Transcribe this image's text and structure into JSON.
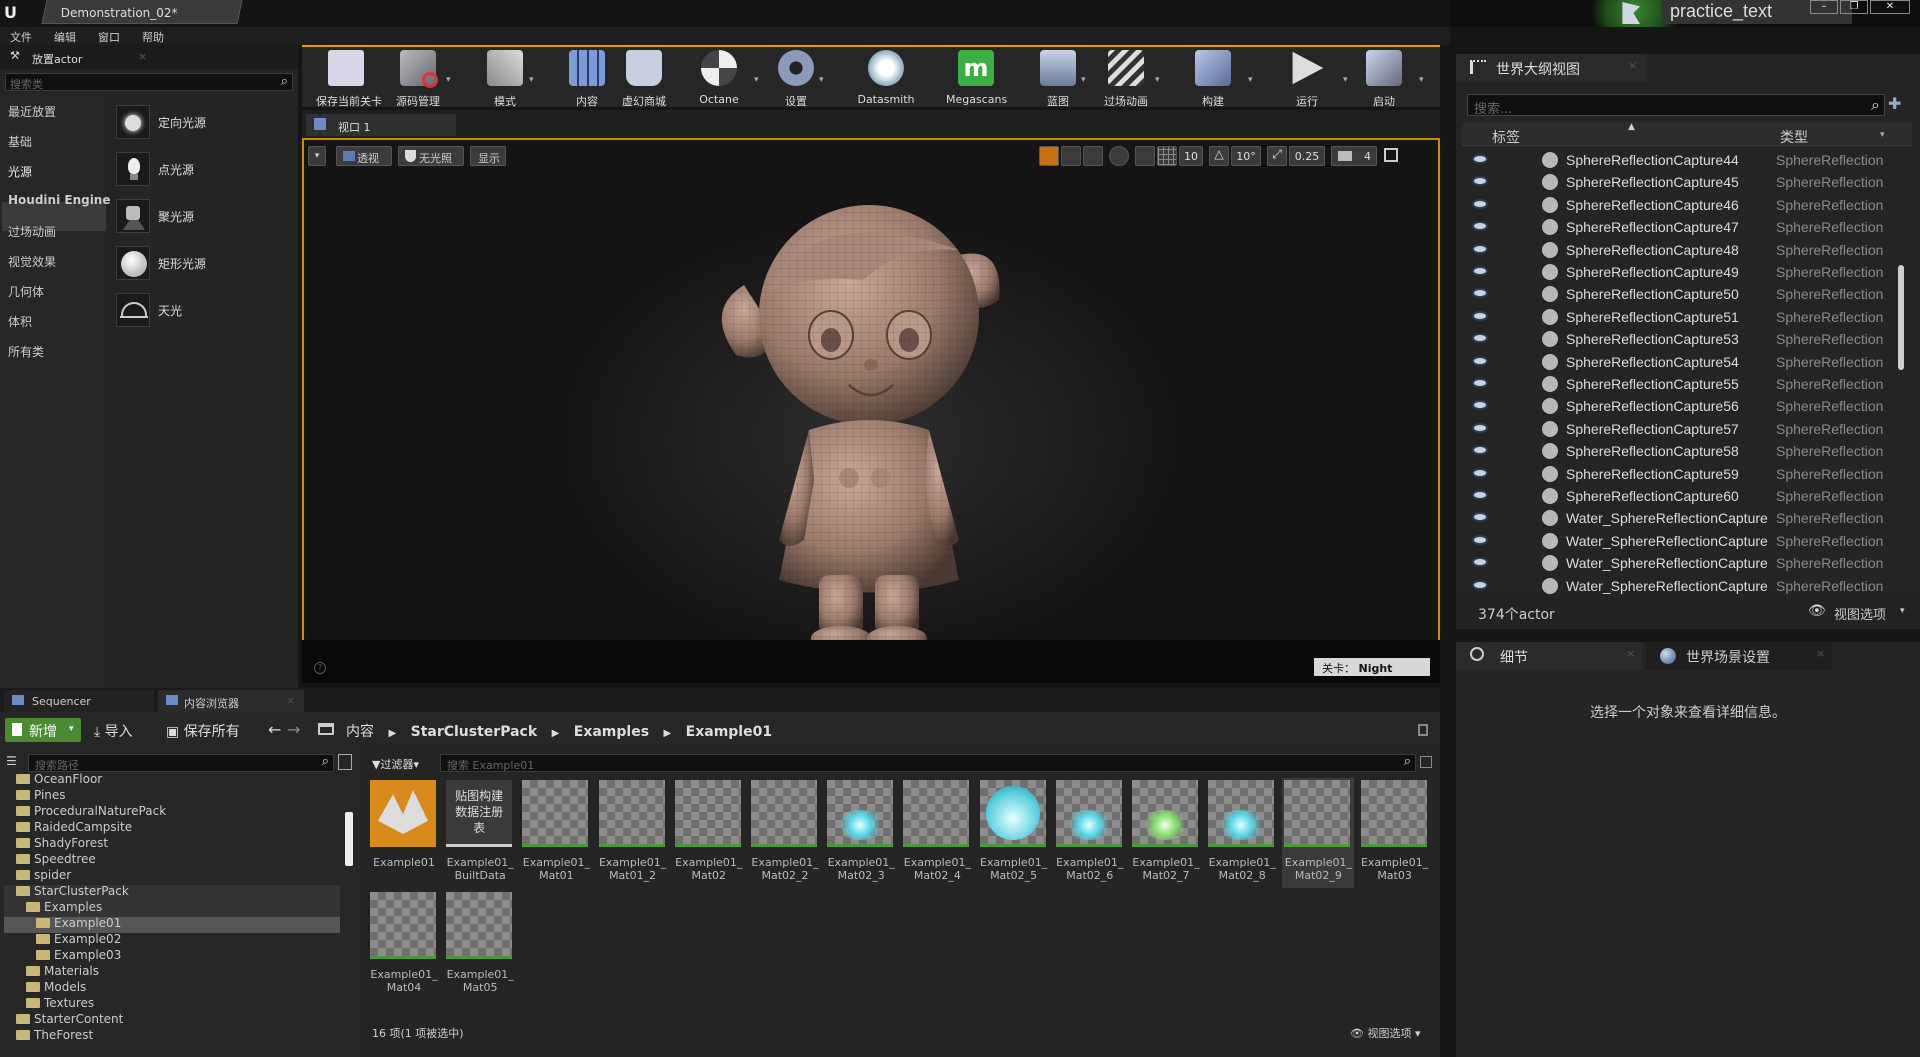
{
  "app": {
    "logo": "unreal-logo-icon",
    "document_tab": "Demonstration_02*"
  },
  "menu": [
    "文件",
    "编辑",
    "窗口",
    "帮助"
  ],
  "project_badge": "practice_text",
  "place_actor": {
    "tab": "放置actor",
    "search_placeholder": "搜索类",
    "categories": [
      "最近放置",
      "基础",
      "光源",
      "Houdini Engine",
      "过场动画",
      "视觉效果",
      "几何体",
      "体积",
      "所有类"
    ],
    "selected_category": "光源",
    "items": [
      "定向光源",
      "点光源",
      "聚光源",
      "矩形光源",
      "天光"
    ]
  },
  "toolbar": [
    {
      "label": "保存当前关卡",
      "icon": "save-icon"
    },
    {
      "label": "源码管理",
      "icon": "source-control-icon"
    },
    {
      "label": "模式",
      "icon": "modes-icon"
    },
    {
      "label": "内容",
      "icon": "content-icon"
    },
    {
      "label": "虚幻商城",
      "icon": "marketplace-icon"
    },
    {
      "label": "Octane",
      "icon": "octane-icon"
    },
    {
      "label": "设置",
      "icon": "settings-icon"
    },
    {
      "label": "Datasmith",
      "icon": "datasmith-icon"
    },
    {
      "label": "Megascans",
      "icon": "megascans-icon"
    },
    {
      "label": "蓝图",
      "icon": "blueprint-icon"
    },
    {
      "label": "过场动画",
      "icon": "cinematics-icon"
    },
    {
      "label": "构建",
      "icon": "build-icon"
    },
    {
      "label": "运行",
      "icon": "play-icon"
    },
    {
      "label": "启动",
      "icon": "launch-icon"
    }
  ],
  "viewport": {
    "tab": "视口 1",
    "perspective": "透视",
    "lighting": "无光照",
    "show": "显示",
    "grid_snap": "10",
    "rot_snap": "10°",
    "scale_snap": "0.25",
    "camera_speed": "4",
    "level_label": "关卡：",
    "level_name": "Night"
  },
  "outliner": {
    "tab": "世界大纲视图",
    "search_placeholder": "搜索...",
    "col_label": "标签",
    "col_type": "类型",
    "rows": [
      {
        "name": "SphereReflectionCapture44",
        "type": "SphereReflection"
      },
      {
        "name": "SphereReflectionCapture45",
        "type": "SphereReflection"
      },
      {
        "name": "SphereReflectionCapture46",
        "type": "SphereReflection"
      },
      {
        "name": "SphereReflectionCapture47",
        "type": "SphereReflection"
      },
      {
        "name": "SphereReflectionCapture48",
        "type": "SphereReflection"
      },
      {
        "name": "SphereReflectionCapture49",
        "type": "SphereReflection"
      },
      {
        "name": "SphereReflectionCapture50",
        "type": "SphereReflection"
      },
      {
        "name": "SphereReflectionCapture51",
        "type": "SphereReflection"
      },
      {
        "name": "SphereReflectionCapture53",
        "type": "SphereReflection"
      },
      {
        "name": "SphereReflectionCapture54",
        "type": "SphereReflection"
      },
      {
        "name": "SphereReflectionCapture55",
        "type": "SphereReflection"
      },
      {
        "name": "SphereReflectionCapture56",
        "type": "SphereReflection"
      },
      {
        "name": "SphereReflectionCapture57",
        "type": "SphereReflection"
      },
      {
        "name": "SphereReflectionCapture58",
        "type": "SphereReflection"
      },
      {
        "name": "SphereReflectionCapture59",
        "type": "SphereReflection"
      },
      {
        "name": "SphereReflectionCapture60",
        "type": "SphereReflection"
      },
      {
        "name": "Water_SphereReflectionCapture",
        "type": "SphereReflection"
      },
      {
        "name": "Water_SphereReflectionCapture",
        "type": "SphereReflection"
      },
      {
        "name": "Water_SphereReflectionCapture",
        "type": "SphereReflection"
      },
      {
        "name": "Water_SphereReflectionCapture",
        "type": "SphereReflection"
      }
    ],
    "count": "374个actor",
    "view_options": "视图选项"
  },
  "details": {
    "tab": "细节",
    "tab2": "世界场景设置",
    "empty_msg": "选择一个对象来查看详细信息。"
  },
  "bottom_tabs": [
    "Sequencer",
    "内容浏览器"
  ],
  "content_browser": {
    "add_new": "新增",
    "import": "导入",
    "save_all": "保存所有",
    "path": [
      "内容",
      "StarClusterPack",
      "Examples",
      "Example01"
    ],
    "search_paths_placeholder": "搜索路径",
    "filters": "过滤器",
    "search_placeholder": "搜索 Example01",
    "tree": [
      {
        "name": "OceanFloor",
        "indent": 0
      },
      {
        "name": "Pines",
        "indent": 0
      },
      {
        "name": "ProceduralNaturePack",
        "indent": 0
      },
      {
        "name": "RaidedCampsite",
        "indent": 0
      },
      {
        "name": "ShadyForest",
        "indent": 0
      },
      {
        "name": "Speedtree",
        "indent": 0
      },
      {
        "name": "spider",
        "indent": 0
      },
      {
        "name": "StarClusterPack",
        "indent": 0
      },
      {
        "name": "Examples",
        "indent": 1
      },
      {
        "name": "Example01",
        "indent": 2
      },
      {
        "name": "Example02",
        "indent": 2
      },
      {
        "name": "Example03",
        "indent": 2
      },
      {
        "name": "Materials",
        "indent": 1
      },
      {
        "name": "Models",
        "indent": 1
      },
      {
        "name": "Textures",
        "indent": 1
      },
      {
        "name": "StarterContent",
        "indent": 0
      },
      {
        "name": "TheForest",
        "indent": 0
      }
    ],
    "assets": [
      {
        "name": "Example01",
        "kind": "level"
      },
      {
        "name": "Example01_\nBuiltData",
        "kind": "builtdata",
        "thumb_text": "贴图构建\n数据注册\n表"
      },
      {
        "name": "Example01_\nMat01",
        "kind": "mat"
      },
      {
        "name": "Example01_\nMat01_2",
        "kind": "mat"
      },
      {
        "name": "Example01_\nMat02",
        "kind": "mat"
      },
      {
        "name": "Example01_\nMat02_2",
        "kind": "mat"
      },
      {
        "name": "Example01_\nMat02_3",
        "kind": "glow"
      },
      {
        "name": "Example01_\nMat02_4",
        "kind": "mat"
      },
      {
        "name": "Example01_\nMat02_5",
        "kind": "sphere"
      },
      {
        "name": "Example01_\nMat02_6",
        "kind": "glow"
      },
      {
        "name": "Example01_\nMat02_7",
        "kind": "glowgreen"
      },
      {
        "name": "Example01_\nMat02_8",
        "kind": "glow"
      },
      {
        "name": "Example01_\nMat02_9",
        "kind": "mat"
      },
      {
        "name": "Example01_\nMat03",
        "kind": "mat"
      },
      {
        "name": "Example01_\nMat04",
        "kind": "mat"
      },
      {
        "name": "Example01_\nMat05",
        "kind": "mat"
      }
    ],
    "status": "16 项(1 项被选中)",
    "view_options": "视图选项"
  }
}
